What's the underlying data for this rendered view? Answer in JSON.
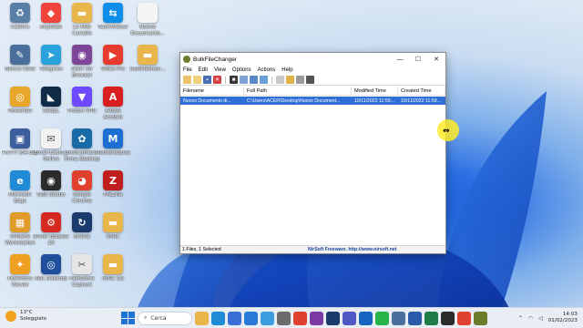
{
  "desktop": {
    "icons": [
      {
        "label": "Cestino",
        "icon": "recycle-bin-icon",
        "color": "#5a7fa6",
        "glyph": "♻"
      },
      {
        "label": "AnyDesk",
        "icon": "anydesk-icon",
        "color": "#ef443b",
        "glyph": "◆"
      },
      {
        "label": "Le Miei Cartelle",
        "icon": "folder-icon",
        "color": "#e8b64a",
        "glyph": "▬"
      },
      {
        "label": "TeamViewer",
        "icon": "teamviewer-icon",
        "color": "#0e8ee9",
        "glyph": "⇆"
      },
      {
        "label": "Nuovo Documento...",
        "icon": "document-icon",
        "color": "#f4f4f4",
        "glyph": ""
      },
      {
        "label": "Blocco Note",
        "icon": "notepad-icon",
        "color": "#4a6f9c",
        "glyph": "✎"
      },
      {
        "label": "Telegram",
        "icon": "telegram-icon",
        "color": "#2aa2dc",
        "glyph": "➤"
      },
      {
        "label": "Start Tor Browser",
        "icon": "tor-icon",
        "color": "#7d4698",
        "glyph": "◉"
      },
      {
        "label": "Video Pro",
        "icon": "video-icon",
        "color": "#e83a2f",
        "glyph": "▶"
      },
      {
        "label": "bulkfilechan...",
        "icon": "folder-icon",
        "color": "#e8b64a",
        "glyph": "▬"
      },
      {
        "label": "PowerISO",
        "icon": "poweriso-icon",
        "color": "#e8a62a",
        "glyph": "◎"
      },
      {
        "label": "DeepL",
        "icon": "deepl-icon",
        "color": "#0f2b46",
        "glyph": "◣"
      },
      {
        "label": "Proton VPN",
        "icon": "protonvpn-icon",
        "color": "#6d4aff",
        "glyph": "▼"
      },
      {
        "label": "Adobe Acrobat",
        "icon": "acrobat-icon",
        "color": "#d81e1e",
        "glyph": "A"
      },
      {
        "label": "PuTTY (64-bit)",
        "icon": "putty-icon",
        "color": "#3c5e9c",
        "glyph": "▣"
      },
      {
        "label": "Email Backup Online",
        "icon": "email-icon",
        "color": "#f2f2f2",
        "glyph": "✉"
      },
      {
        "label": "InfoCamere Firma Desktop",
        "icon": "infocamere-icon",
        "color": "#1b6aa8",
        "glyph": "✿"
      },
      {
        "label": "Malwarebytes",
        "icon": "malwarebytes-icon",
        "color": "#1d6fd1",
        "glyph": "M"
      },
      {
        "label": "Microsoft Edge",
        "icon": "edge-icon",
        "color": "#1f8ad6",
        "glyph": "e"
      },
      {
        "label": "OBS Studio",
        "icon": "obs-icon",
        "color": "#2b2b2b",
        "glyph": "◉"
      },
      {
        "label": "Google Chrome",
        "icon": "chrome-icon",
        "color": "#e0412f",
        "glyph": "◕"
      },
      {
        "label": "FileZilla",
        "icon": "filezilla-icon",
        "color": "#bf1e1e",
        "glyph": "Z"
      },
      {
        "label": "VMware Workstation",
        "icon": "vmware-icon",
        "color": "#e29a2b",
        "glyph": "▦"
      },
      {
        "label": "Driver Booster 10",
        "icon": "driverbooster-icon",
        "color": "#d42a1f",
        "glyph": "⚙"
      },
      {
        "label": "Brevia",
        "icon": "brevia-icon",
        "color": "#1b3b6f",
        "glyph": "↻"
      },
      {
        "label": "mIRC",
        "icon": "folder-icon",
        "color": "#e8b64a",
        "glyph": "▬"
      },
      {
        "label": "FastStone Viewer",
        "icon": "faststone-icon",
        "color": "#f0a020",
        "glyph": "✦"
      },
      {
        "label": "AOL Desktop",
        "icon": "aol-icon",
        "color": "#1e4e9c",
        "glyph": "◎"
      },
      {
        "label": "FastStone Capture",
        "icon": "capture-icon",
        "color": "#e6e6e6",
        "glyph": "✂"
      },
      {
        "label": "mIRC (2)",
        "icon": "folder-icon",
        "color": "#e8b64a",
        "glyph": "▬"
      }
    ]
  },
  "window": {
    "title": "BulkFileChanger",
    "menu": [
      "File",
      "Edit",
      "View",
      "Options",
      "Actions",
      "Help"
    ],
    "columns": [
      "Filename",
      "Full Path",
      "Modified Time",
      "Created Time"
    ],
    "rows": [
      {
        "filename": "Nuovo Documento di...",
        "full_path": "C:\\Users\\ACER\\Desktop\\Nuovo Document...",
        "modified": "10/11/2022 11:59...",
        "created": "10/11/2022 11:59..."
      }
    ],
    "status_left": "1 Files, 1 Selected",
    "status_right": "NirSoft Freeware.  http://www.nirsoft.net"
  },
  "taskbar": {
    "weather_temp": "13°C",
    "weather_desc": "Soleggiato",
    "search_placeholder": "Cerca",
    "time": "14:03",
    "date": "01/02/2023",
    "pinned": [
      {
        "icon": "file-explorer-icon",
        "color": "#e8b64a"
      },
      {
        "icon": "edge-icon",
        "color": "#1f8ad6"
      },
      {
        "icon": "store-icon",
        "color": "#3a6fd8"
      },
      {
        "icon": "mail-icon",
        "color": "#2a7ad8"
      },
      {
        "icon": "photos-icon",
        "color": "#3b9de0"
      },
      {
        "icon": "settings-icon",
        "color": "#6b6b6b"
      },
      {
        "icon": "chrome-icon",
        "color": "#e0412f"
      },
      {
        "icon": "onenote-icon",
        "color": "#7c3aa5"
      },
      {
        "icon": "brevia-icon",
        "color": "#1b3b6f"
      },
      {
        "icon": "teams-icon",
        "color": "#5058c6"
      },
      {
        "icon": "outlook-icon",
        "color": "#1565c0"
      },
      {
        "icon": "whatsapp-icon",
        "color": "#27b44a"
      },
      {
        "icon": "notepad-icon",
        "color": "#4a6f9c"
      },
      {
        "icon": "word-icon",
        "color": "#2b5aa8"
      },
      {
        "icon": "excel-icon",
        "color": "#1e7c46"
      },
      {
        "icon": "obs-icon",
        "color": "#2b2b2b"
      },
      {
        "icon": "chrome-icon",
        "color": "#e0412f"
      },
      {
        "icon": "bulkfilechanger-icon",
        "color": "#6a7c2c"
      }
    ]
  }
}
